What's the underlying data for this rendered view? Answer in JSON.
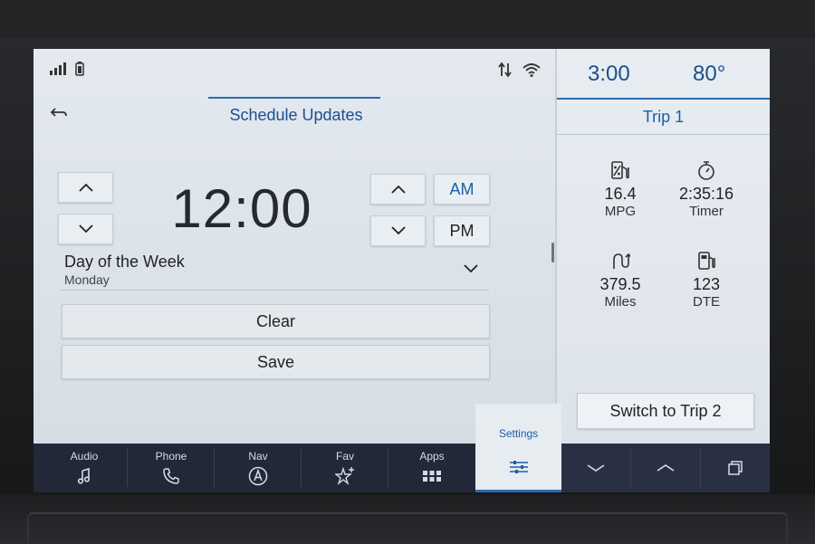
{
  "status": {
    "left_icons": [
      "signal-icon",
      "phone-battery-icon"
    ],
    "right_icons": [
      "data-transfer-icon",
      "wifi-icon"
    ]
  },
  "main": {
    "title": "Schedule Updates",
    "time": "12:00",
    "am_label": "AM",
    "pm_label": "PM",
    "selected_period": "AM",
    "day_of_week_label": "Day of the Week",
    "day_of_week_value": "Monday",
    "clear_label": "Clear",
    "save_label": "Save"
  },
  "trip": {
    "clock": "3:00",
    "temperature": "80°",
    "name": "Trip 1",
    "stats": [
      {
        "icon": "fuel-economy-icon",
        "value": "16.4",
        "unit": "MPG"
      },
      {
        "icon": "stopwatch-icon",
        "value": "2:35:16",
        "unit": "Timer"
      },
      {
        "icon": "route-icon",
        "value": "379.5",
        "unit": "Miles"
      },
      {
        "icon": "fuel-pump-icon",
        "value": "123",
        "unit": "DTE"
      }
    ],
    "switch_label": "Switch to Trip 2"
  },
  "nav": {
    "items": [
      {
        "label": "Audio",
        "icon": "music-note-icon"
      },
      {
        "label": "Phone",
        "icon": "phone-icon"
      },
      {
        "label": "Nav",
        "icon": "navigation-icon"
      },
      {
        "label": "Fav",
        "icon": "star-add-icon"
      },
      {
        "label": "Apps",
        "icon": "apps-grid-icon"
      }
    ],
    "settings_label": "Settings",
    "settings_icon": "sliders-icon",
    "right_icons": [
      "chevron-down-icon",
      "chevron-up-icon",
      "cards-icon"
    ]
  },
  "colors": {
    "accent": "#1c5fa8",
    "nav_bg": "#232838",
    "panel_bg": "#dfe5ec"
  }
}
